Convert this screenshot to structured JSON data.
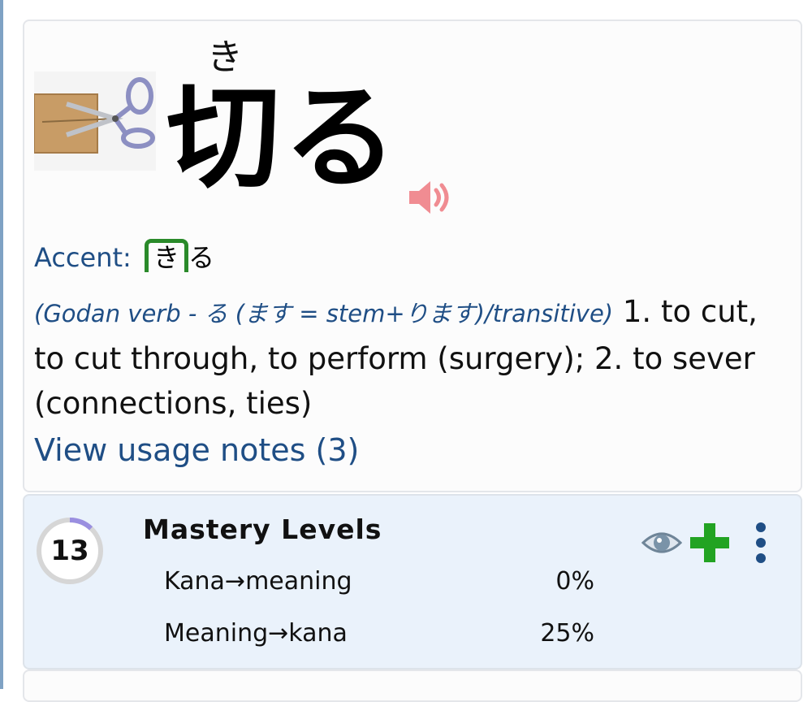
{
  "word": {
    "furigana": "き",
    "headword": "切る",
    "image_icon": "scissors-cutting-cardboard-image",
    "audio_icon": "speaker-icon",
    "accent": {
      "label": "Accent",
      "high_mora": "き",
      "low_mora": "る",
      "color": "#2a8a2a"
    },
    "definition": {
      "pos": "(Godan verb - る (ます = stem+ります)/transitive)",
      "text": " 1. to cut, to cut through, to perform (surgery); 2. to sever (connections, ties)"
    },
    "usage_link": "View usage notes (3)"
  },
  "mastery": {
    "level": "13",
    "level_progress": 0.12,
    "title": "Mastery Levels",
    "rows": [
      {
        "label": "Kana→meaning",
        "percent": "0%"
      },
      {
        "label": "Meaning→kana",
        "percent": "25%"
      }
    ],
    "actions": {
      "visibility_icon": "eye-icon",
      "add_icon": "plus-icon",
      "menu_icon": "more-vertical-icon"
    }
  },
  "colors": {
    "link": "#1f4e85",
    "accent_green": "#2a8a2a",
    "add_green": "#22a322",
    "audio_pink": "#f08c92",
    "mastery_bg": "#eaf2fb",
    "ring_progress": "#9a8fe0"
  }
}
